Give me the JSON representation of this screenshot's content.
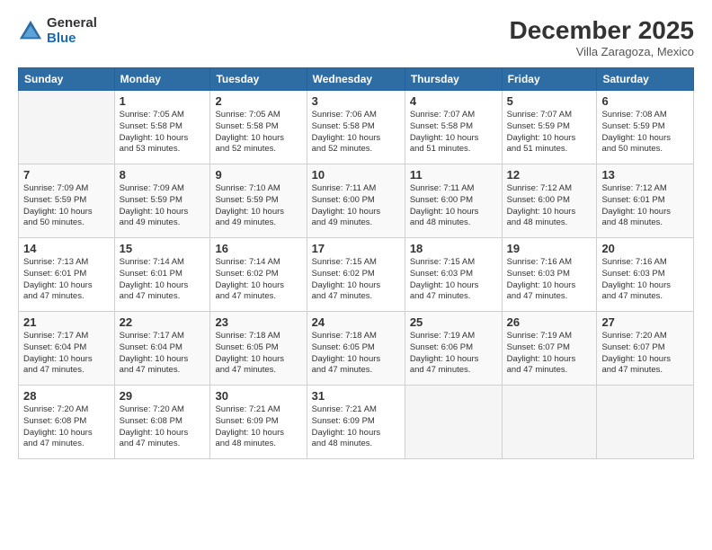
{
  "logo": {
    "line1": "General",
    "line2": "Blue"
  },
  "title": "December 2025",
  "location": "Villa Zaragoza, Mexico",
  "weekdays": [
    "Sunday",
    "Monday",
    "Tuesday",
    "Wednesday",
    "Thursday",
    "Friday",
    "Saturday"
  ],
  "weeks": [
    [
      {
        "day": "",
        "info": ""
      },
      {
        "day": "1",
        "info": "Sunrise: 7:05 AM\nSunset: 5:58 PM\nDaylight: 10 hours\nand 53 minutes."
      },
      {
        "day": "2",
        "info": "Sunrise: 7:05 AM\nSunset: 5:58 PM\nDaylight: 10 hours\nand 52 minutes."
      },
      {
        "day": "3",
        "info": "Sunrise: 7:06 AM\nSunset: 5:58 PM\nDaylight: 10 hours\nand 52 minutes."
      },
      {
        "day": "4",
        "info": "Sunrise: 7:07 AM\nSunset: 5:58 PM\nDaylight: 10 hours\nand 51 minutes."
      },
      {
        "day": "5",
        "info": "Sunrise: 7:07 AM\nSunset: 5:59 PM\nDaylight: 10 hours\nand 51 minutes."
      },
      {
        "day": "6",
        "info": "Sunrise: 7:08 AM\nSunset: 5:59 PM\nDaylight: 10 hours\nand 50 minutes."
      }
    ],
    [
      {
        "day": "7",
        "info": "Sunrise: 7:09 AM\nSunset: 5:59 PM\nDaylight: 10 hours\nand 50 minutes."
      },
      {
        "day": "8",
        "info": "Sunrise: 7:09 AM\nSunset: 5:59 PM\nDaylight: 10 hours\nand 49 minutes."
      },
      {
        "day": "9",
        "info": "Sunrise: 7:10 AM\nSunset: 5:59 PM\nDaylight: 10 hours\nand 49 minutes."
      },
      {
        "day": "10",
        "info": "Sunrise: 7:11 AM\nSunset: 6:00 PM\nDaylight: 10 hours\nand 49 minutes."
      },
      {
        "day": "11",
        "info": "Sunrise: 7:11 AM\nSunset: 6:00 PM\nDaylight: 10 hours\nand 48 minutes."
      },
      {
        "day": "12",
        "info": "Sunrise: 7:12 AM\nSunset: 6:00 PM\nDaylight: 10 hours\nand 48 minutes."
      },
      {
        "day": "13",
        "info": "Sunrise: 7:12 AM\nSunset: 6:01 PM\nDaylight: 10 hours\nand 48 minutes."
      }
    ],
    [
      {
        "day": "14",
        "info": "Sunrise: 7:13 AM\nSunset: 6:01 PM\nDaylight: 10 hours\nand 47 minutes."
      },
      {
        "day": "15",
        "info": "Sunrise: 7:14 AM\nSunset: 6:01 PM\nDaylight: 10 hours\nand 47 minutes."
      },
      {
        "day": "16",
        "info": "Sunrise: 7:14 AM\nSunset: 6:02 PM\nDaylight: 10 hours\nand 47 minutes."
      },
      {
        "day": "17",
        "info": "Sunrise: 7:15 AM\nSunset: 6:02 PM\nDaylight: 10 hours\nand 47 minutes."
      },
      {
        "day": "18",
        "info": "Sunrise: 7:15 AM\nSunset: 6:03 PM\nDaylight: 10 hours\nand 47 minutes."
      },
      {
        "day": "19",
        "info": "Sunrise: 7:16 AM\nSunset: 6:03 PM\nDaylight: 10 hours\nand 47 minutes."
      },
      {
        "day": "20",
        "info": "Sunrise: 7:16 AM\nSunset: 6:03 PM\nDaylight: 10 hours\nand 47 minutes."
      }
    ],
    [
      {
        "day": "21",
        "info": "Sunrise: 7:17 AM\nSunset: 6:04 PM\nDaylight: 10 hours\nand 47 minutes."
      },
      {
        "day": "22",
        "info": "Sunrise: 7:17 AM\nSunset: 6:04 PM\nDaylight: 10 hours\nand 47 minutes."
      },
      {
        "day": "23",
        "info": "Sunrise: 7:18 AM\nSunset: 6:05 PM\nDaylight: 10 hours\nand 47 minutes."
      },
      {
        "day": "24",
        "info": "Sunrise: 7:18 AM\nSunset: 6:05 PM\nDaylight: 10 hours\nand 47 minutes."
      },
      {
        "day": "25",
        "info": "Sunrise: 7:19 AM\nSunset: 6:06 PM\nDaylight: 10 hours\nand 47 minutes."
      },
      {
        "day": "26",
        "info": "Sunrise: 7:19 AM\nSunset: 6:07 PM\nDaylight: 10 hours\nand 47 minutes."
      },
      {
        "day": "27",
        "info": "Sunrise: 7:20 AM\nSunset: 6:07 PM\nDaylight: 10 hours\nand 47 minutes."
      }
    ],
    [
      {
        "day": "28",
        "info": "Sunrise: 7:20 AM\nSunset: 6:08 PM\nDaylight: 10 hours\nand 47 minutes."
      },
      {
        "day": "29",
        "info": "Sunrise: 7:20 AM\nSunset: 6:08 PM\nDaylight: 10 hours\nand 47 minutes."
      },
      {
        "day": "30",
        "info": "Sunrise: 7:21 AM\nSunset: 6:09 PM\nDaylight: 10 hours\nand 48 minutes."
      },
      {
        "day": "31",
        "info": "Sunrise: 7:21 AM\nSunset: 6:09 PM\nDaylight: 10 hours\nand 48 minutes."
      },
      {
        "day": "",
        "info": ""
      },
      {
        "day": "",
        "info": ""
      },
      {
        "day": "",
        "info": ""
      }
    ]
  ]
}
